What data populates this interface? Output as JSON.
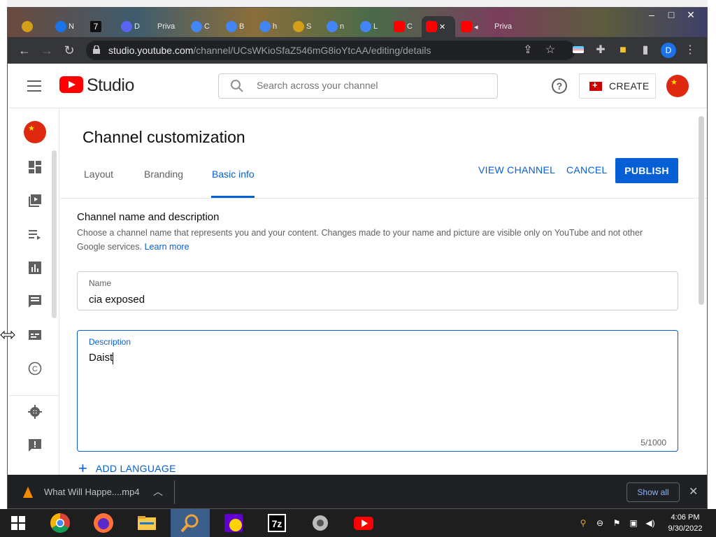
{
  "browser": {
    "tabs": [
      {
        "label": "",
        "color": "#d4a017"
      },
      {
        "label": "N",
        "color": "#1a73e8"
      },
      {
        "label": "",
        "color": "#111111"
      },
      {
        "label": "D",
        "color": "#5865f2"
      },
      {
        "label": "Priva",
        "color": "#888888"
      },
      {
        "label": "C",
        "color": "#4285f4"
      },
      {
        "label": "B",
        "color": "#4285f4"
      },
      {
        "label": "h",
        "color": "#4285f4"
      },
      {
        "label": "S",
        "color": "#d4a017"
      },
      {
        "label": "n",
        "color": "#4285f4"
      },
      {
        "label": "L",
        "color": "#4285f4"
      },
      {
        "label": "C",
        "color": "#ff0000"
      },
      {
        "label": "",
        "color": "#ff0000"
      },
      {
        "label": "",
        "color": "#ff0000"
      },
      {
        "label": "Priva",
        "color": "#888888"
      }
    ],
    "tab_badge": "7",
    "url_host": "studio.youtube.com",
    "url_path": "/channel/UCsWKioSfaZ546mG8ioYtcAA/editing/details",
    "profile_initial": "D",
    "window_buttons": {
      "minimize": "–",
      "maximize": "□",
      "close": "✕"
    }
  },
  "studio": {
    "logo_text": "Studio",
    "search_placeholder": "Search across your channel",
    "help_glyph": "?",
    "create_label": "CREATE"
  },
  "nav": {
    "items": [
      "dashboard",
      "content",
      "playlists",
      "analytics",
      "comments",
      "subtitles",
      "copyright",
      "settings",
      "feedback"
    ]
  },
  "main": {
    "title": "Channel customization",
    "tabs": [
      {
        "label": "Layout",
        "active": false
      },
      {
        "label": "Branding",
        "active": false
      },
      {
        "label": "Basic info",
        "active": true
      }
    ],
    "view_channel": "VIEW CHANNEL",
    "cancel": "CANCEL",
    "publish": "PUBLISH",
    "section_title": "Channel name and description",
    "section_desc": "Choose a channel name that represents you and your content. Changes made to your name and picture are visible only on YouTube and not other Google services.",
    "learn_more": "Learn more",
    "name_label": "Name",
    "name_value": "cia exposed",
    "description_label": "Description",
    "description_value": "Daist",
    "description_counter": "5/1000",
    "add_language": "ADD LANGUAGE"
  },
  "downloads": {
    "file_name": "What Will Happe....mp4",
    "show_all": "Show all",
    "close": "✕"
  },
  "taskbar": {
    "time": "4:06 PM",
    "date": "9/30/2022"
  },
  "colors": {
    "accent": "#065fd4",
    "youtube_red": "#ff0000",
    "avatar_red": "#de2910"
  }
}
